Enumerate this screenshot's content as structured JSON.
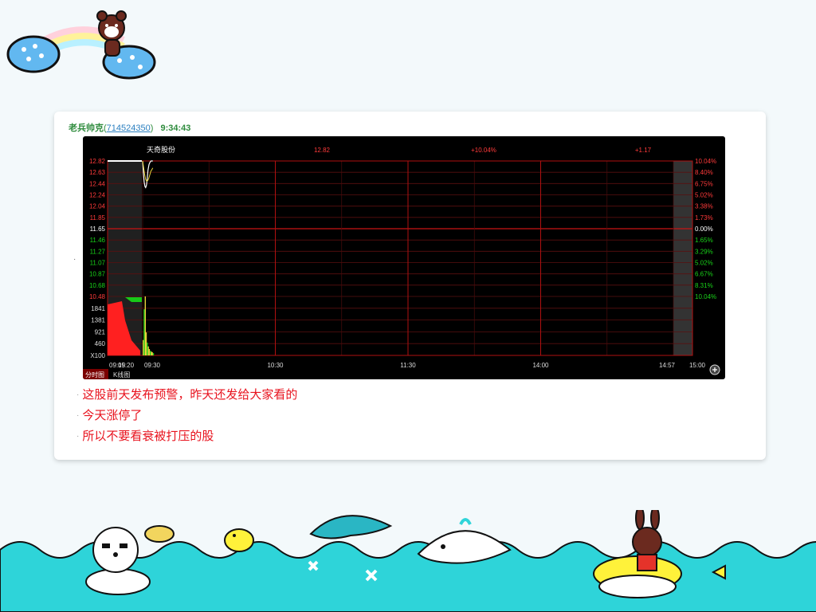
{
  "post": {
    "user": "老兵帅克",
    "uid": "714524350",
    "time": "9:34:43",
    "lines": [
      "这股前天发布预警，昨天还发给大家看的",
      "今天涨停了",
      "所以不要看衰被打压的股"
    ]
  },
  "chart_data": {
    "type": "line",
    "stock_name": "天奇股份",
    "header_price": "12.82",
    "header_change_pct": "+10.04%",
    "header_change": "+1.17",
    "prev_close": 11.65,
    "ylim": [
      10.48,
      12.82
    ],
    "price_ticks": [
      "12.82",
      "12.63",
      "12.44",
      "12.24",
      "12.04",
      "11.85",
      "11.65",
      "11.46",
      "11.27",
      "11.07",
      "10.87",
      "10.68",
      "10.48"
    ],
    "pct_ticks": [
      "10.04%",
      "8.40%",
      "6.75%",
      "5.02%",
      "3.38%",
      "1.73%",
      "0.00%",
      "1.65%",
      "3.29%",
      "5.02%",
      "6.67%",
      "8.31%",
      "10.04%"
    ],
    "volume_ticks": [
      "1841",
      "1381",
      "921",
      "460",
      "X100"
    ],
    "volume_max": 2301,
    "time_ticks": [
      "09:15",
      "09:20",
      "09:30",
      "10:30",
      "11:30",
      "14:00",
      "14:57",
      "15:00"
    ],
    "price_series": {
      "t": [
        30.0,
        30.1,
        30.3,
        30.6,
        30.9,
        31.2,
        31.5,
        31.8,
        32.1,
        32.5,
        32.9,
        33.3,
        33.7,
        34.0
      ],
      "price": [
        12.82,
        12.74,
        12.6,
        12.46,
        12.38,
        12.36,
        12.4,
        12.52,
        12.66,
        12.76,
        12.8,
        12.82,
        12.82,
        12.82
      ]
    },
    "avg_series": {
      "t": [
        30.0,
        30.4,
        30.8,
        31.2,
        31.6,
        32.0,
        32.4,
        32.8,
        33.2,
        34.0
      ],
      "price": [
        12.82,
        12.7,
        12.58,
        12.5,
        12.47,
        12.48,
        12.52,
        12.58,
        12.64,
        12.7
      ]
    },
    "volume_series": {
      "t": [
        30.0,
        30.4,
        30.8,
        31.2,
        31.6,
        32.0,
        32.4,
        32.8,
        33.2,
        33.6,
        34.0
      ],
      "volume": [
        600,
        1800,
        2300,
        900,
        500,
        350,
        250,
        180,
        150,
        120,
        90
      ]
    },
    "tabs": [
      "分时图",
      "K线图"
    ]
  }
}
